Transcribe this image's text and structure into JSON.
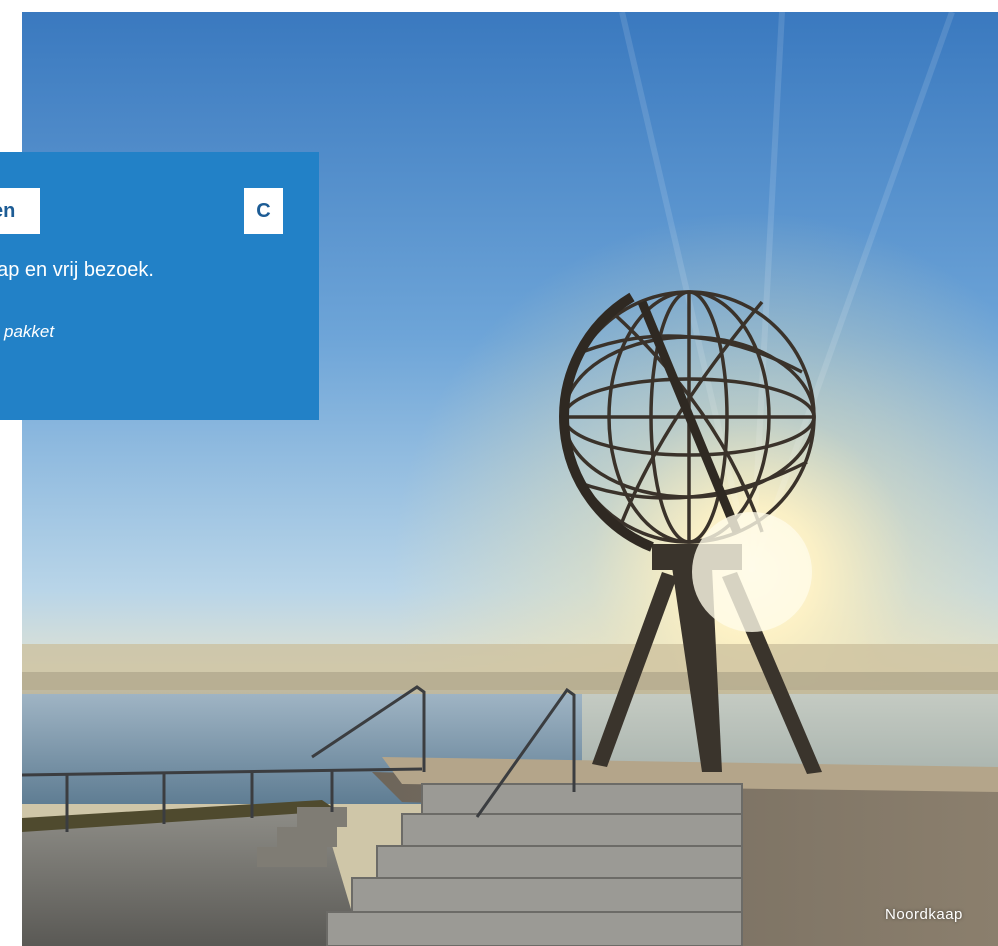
{
  "card": {
    "tag_left": "en",
    "tag_right": "C",
    "line": "kaap en vrij bezoek.",
    "sub": "pakket"
  },
  "photo": {
    "caption": "Noordkaap"
  },
  "colors": {
    "card_background": "#2281c7",
    "tag_text": "#1d5c95",
    "sky_top": "#3f7fc2",
    "sun": "#fff6d6"
  }
}
